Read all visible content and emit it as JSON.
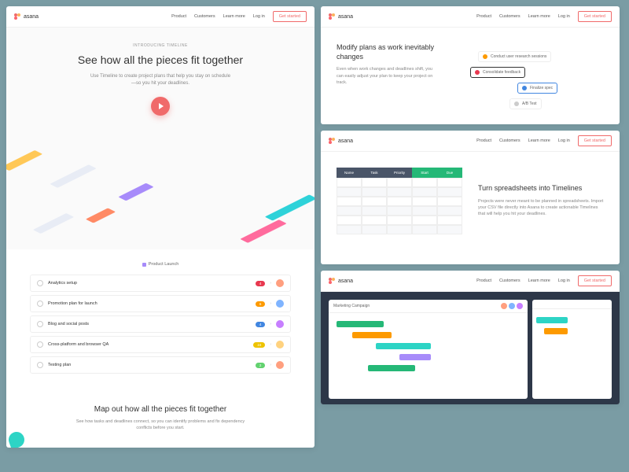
{
  "brand": "asana",
  "nav": {
    "product": "Product",
    "customers": "Customers",
    "learn": "Learn more",
    "login": "Log in",
    "cta": "Get started"
  },
  "hero": {
    "eyebrow": "Introducing Timeline",
    "title": "See how all the pieces fit together",
    "subhead": "Use Timeline to create project plans that help you stay on schedule—so you hit your deadlines."
  },
  "tasks": {
    "project": "Product Launch",
    "items": [
      {
        "name": "Analytics setup",
        "badge": "4",
        "badgeClass": "bred"
      },
      {
        "name": "Promotion plan for launch",
        "badge": "6",
        "badgeClass": "borange"
      },
      {
        "name": "Blog and social posts",
        "badge": "4",
        "badgeClass": "bblue"
      },
      {
        "name": "Cross-platform and browser QA",
        "badge": "24",
        "badgeClass": "byellow"
      },
      {
        "name": "Testing plan",
        "badge": "2",
        "badgeClass": "bgreen"
      }
    ]
  },
  "section2": {
    "title": "Map out how all the pieces fit together",
    "body": "See how tasks and deadlines connect, so you can identify problems and fix dependency conflicts before you start."
  },
  "modify": {
    "title": "Modify plans as work inevitably changes",
    "body": "Even when work changes and deadlines shift, you can easily adjust your plan to keep your project on track.",
    "chips": [
      "Conduct user research sessions",
      "Consolidate feedback",
      "Finalize spec",
      "A/B Test"
    ]
  },
  "spreadsheet": {
    "title": "Turn spreadsheets into Timelines",
    "body": "Projects were never meant to be planned in spreadsheets. Import your CSV file directly into Asana to create actionable Timelines that will help you hit your deadlines.",
    "headers": [
      "Name",
      "Task",
      "Priority",
      "Start",
      "Due"
    ]
  },
  "campaign": {
    "title": "Marketing Campaign"
  }
}
